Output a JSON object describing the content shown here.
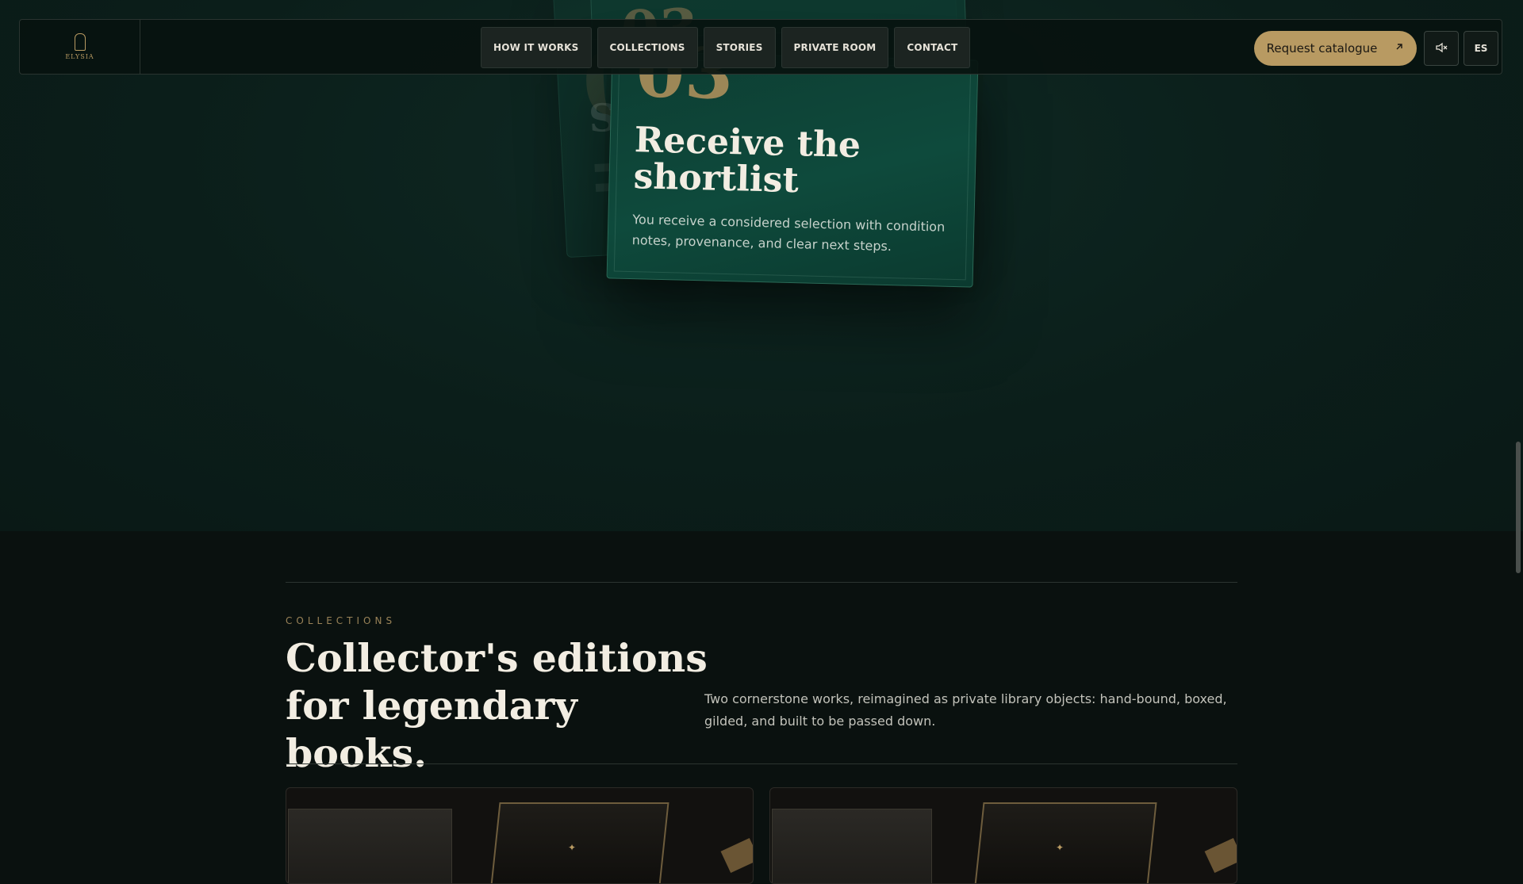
{
  "brand": {
    "name": "ELYSIA",
    "logo": "arch-logo-icon"
  },
  "nav": {
    "links": [
      "HOW IT WORKS",
      "COLLECTIONS",
      "STORIES",
      "PRIVATE ROOM",
      "CONTACT"
    ],
    "cta": {
      "label": "Request catalogue",
      "icon": "arrow-up-right-icon"
    },
    "mute_icon": "speaker-muted-icon",
    "language": "ES"
  },
  "step_card": {
    "number": "03",
    "title": "Receive the shortlist",
    "body": "You receive a considered selection with condition notes, provenance, and clear next steps."
  },
  "collections": {
    "eyebrow": "COLLECTIONS",
    "headline": "Collector's editions for legendary books.",
    "description": "Two cornerstone works, reimagined as private library objects: hand-bound, boxed, gilded, and built to be passed down."
  },
  "colors": {
    "accent": "#b89a62",
    "hero_bg": "#0b1e1a",
    "card_green": "#0e4a3c",
    "page_bg": "#0a110f"
  }
}
